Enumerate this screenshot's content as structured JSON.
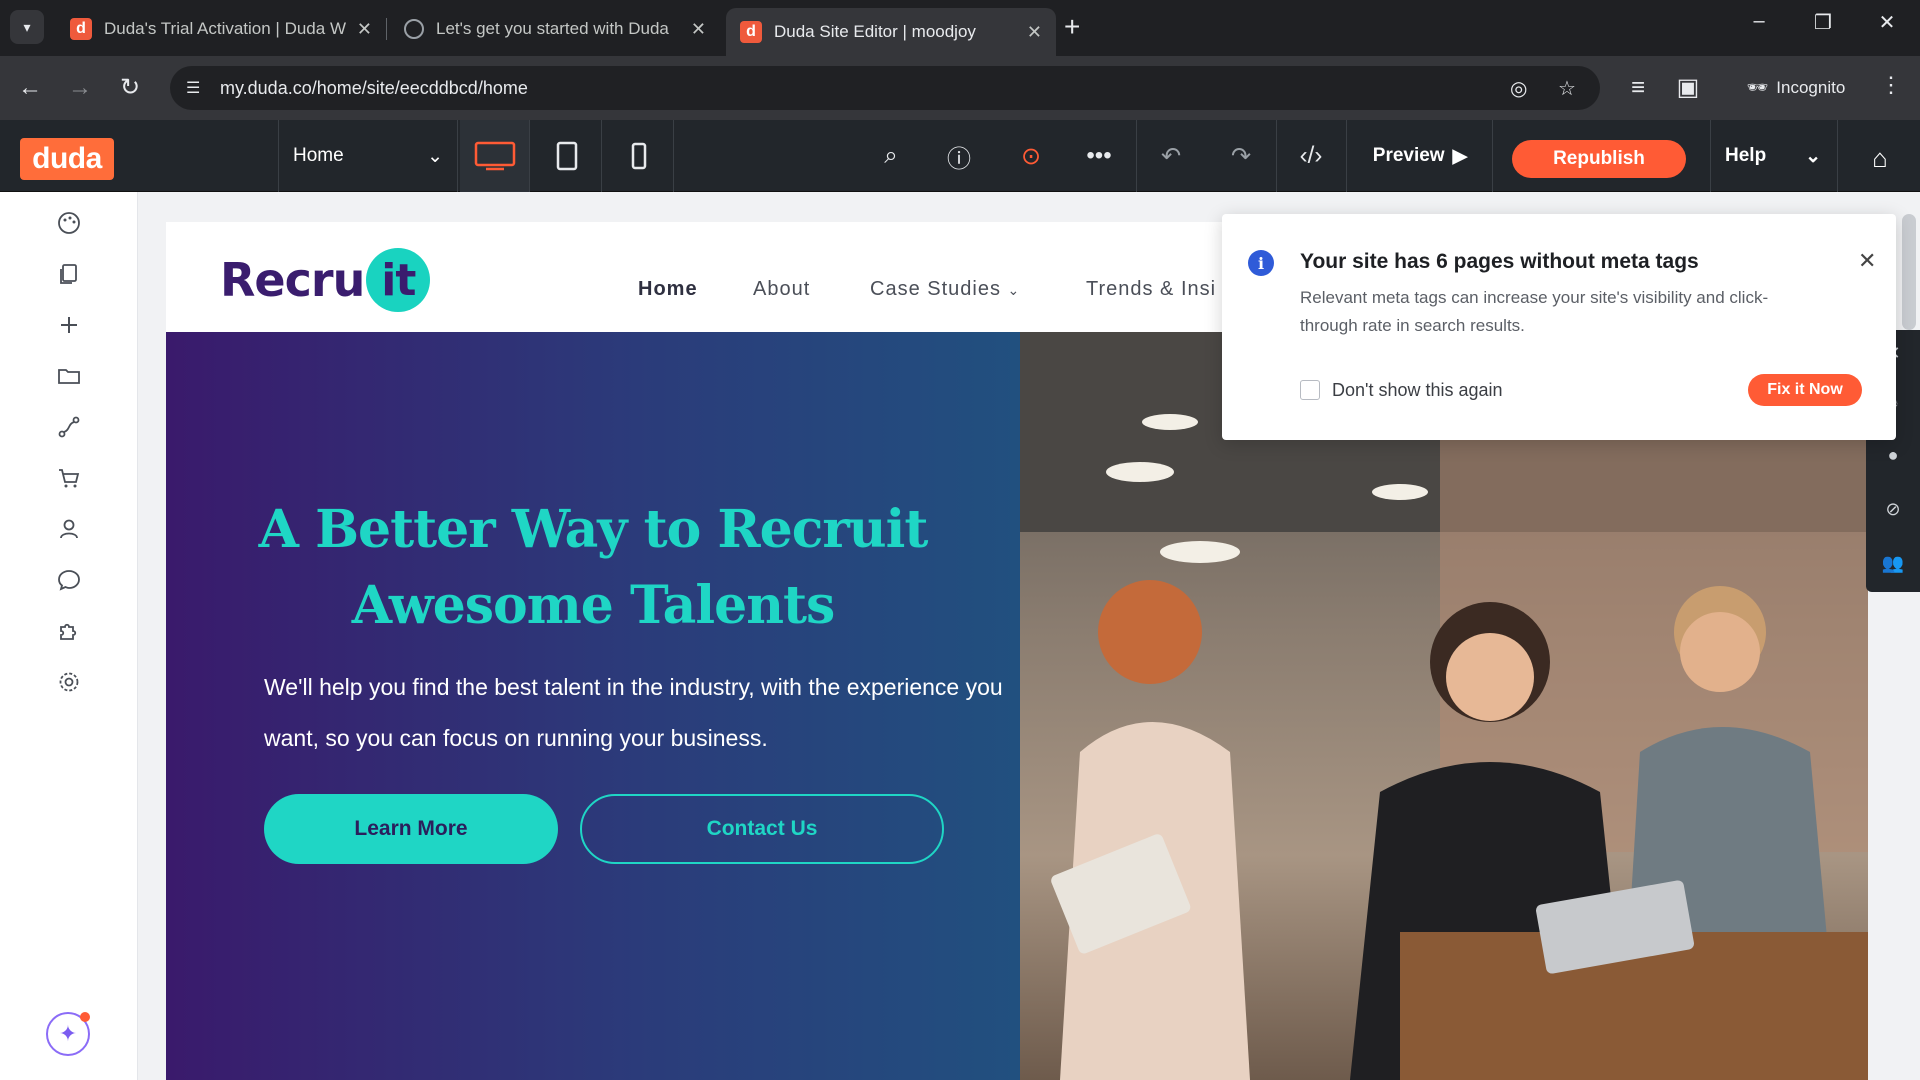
{
  "browser": {
    "tabs": [
      {
        "title": "Duda's Trial Activation | Duda W",
        "favicon": "duda-favicon"
      },
      {
        "title": "Let's get you started with Duda",
        "favicon": "globe-icon"
      },
      {
        "title": "Duda Site Editor | moodjoy",
        "favicon": "duda-favicon"
      }
    ],
    "url": "my.duda.co/home/site/eecddbcd/home",
    "incognito_label": "Incognito"
  },
  "editor": {
    "logo": "duda",
    "page_selector": "Home",
    "preview_label": "Preview",
    "republish_label": "Republish",
    "help_label": "Help",
    "accent_color": "#ff5b35"
  },
  "site": {
    "logo_word": "Recru",
    "logo_badge": "it",
    "nav": [
      "Home",
      "About",
      "Case Studies",
      "Trends & Insi"
    ],
    "hero_heading": "A Better Way to Recruit Awesome Talents",
    "hero_text": "We'll help you find the best talent in the industry, with the experience you want, so you can focus on running your business.",
    "learn_more": "Learn More",
    "contact_us": "Contact Us"
  },
  "notification": {
    "title": "Your site has 6 pages without meta tags",
    "body": "Relevant meta tags can increase your site's visibility and click-through rate in search results.",
    "checkbox_label": "Don't show this again",
    "checkbox_checked": false,
    "action_label": "Fix it Now"
  }
}
